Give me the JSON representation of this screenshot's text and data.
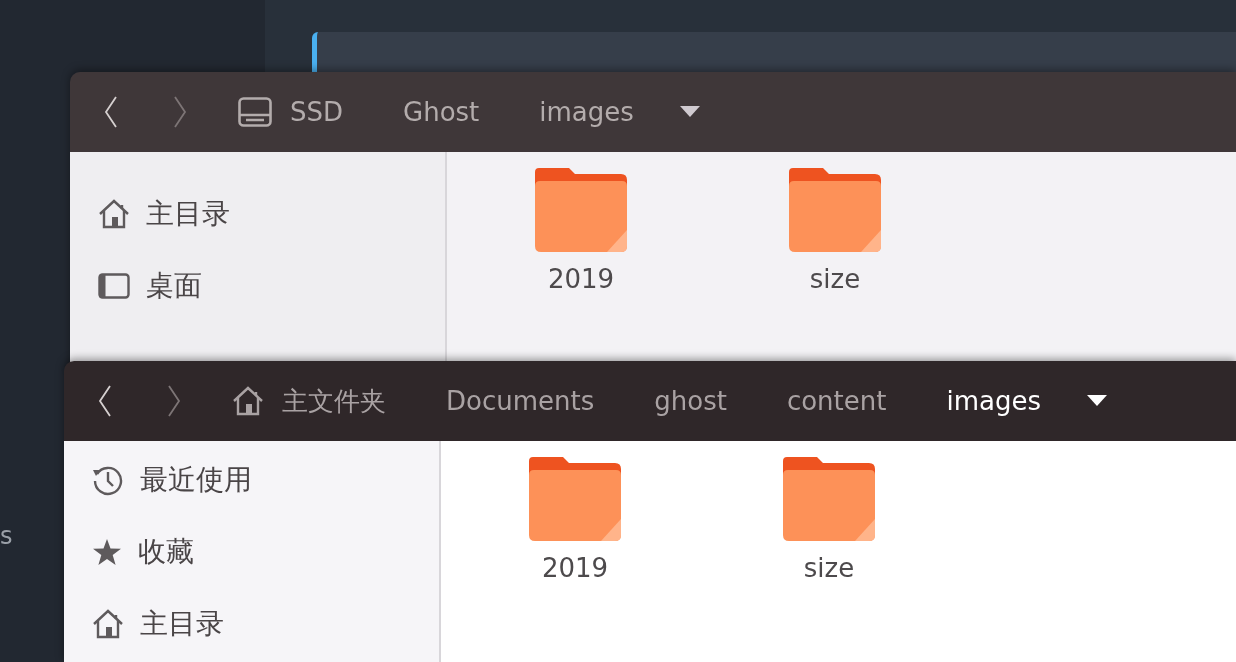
{
  "desktop": {
    "edge_text": "s"
  },
  "windows": [
    {
      "nav": {
        "back_disabled": false,
        "forward_disabled": true
      },
      "path": [
        {
          "label": "SSD",
          "kind": "drive",
          "selected": false
        },
        {
          "label": "Ghost",
          "selected": false
        },
        {
          "label": "images",
          "selected": false
        }
      ],
      "sidebar": [
        {
          "label": "主目录",
          "kind": "home"
        },
        {
          "label": "桌面",
          "kind": "desktop"
        }
      ],
      "files": [
        {
          "name": "2019"
        },
        {
          "name": "size"
        }
      ]
    },
    {
      "nav": {
        "back_disabled": false,
        "forward_disabled": true
      },
      "path": [
        {
          "label": "主文件夹",
          "kind": "home",
          "selected": false
        },
        {
          "label": "Documents",
          "selected": false
        },
        {
          "label": "ghost",
          "selected": false
        },
        {
          "label": "content",
          "selected": false
        },
        {
          "label": "images",
          "selected": true
        }
      ],
      "sidebar": [
        {
          "label": "最近使用",
          "kind": "recent"
        },
        {
          "label": "收藏",
          "kind": "starred"
        },
        {
          "label": "主目录",
          "kind": "home"
        }
      ],
      "files": [
        {
          "name": "2019"
        },
        {
          "name": "size"
        }
      ]
    }
  ]
}
